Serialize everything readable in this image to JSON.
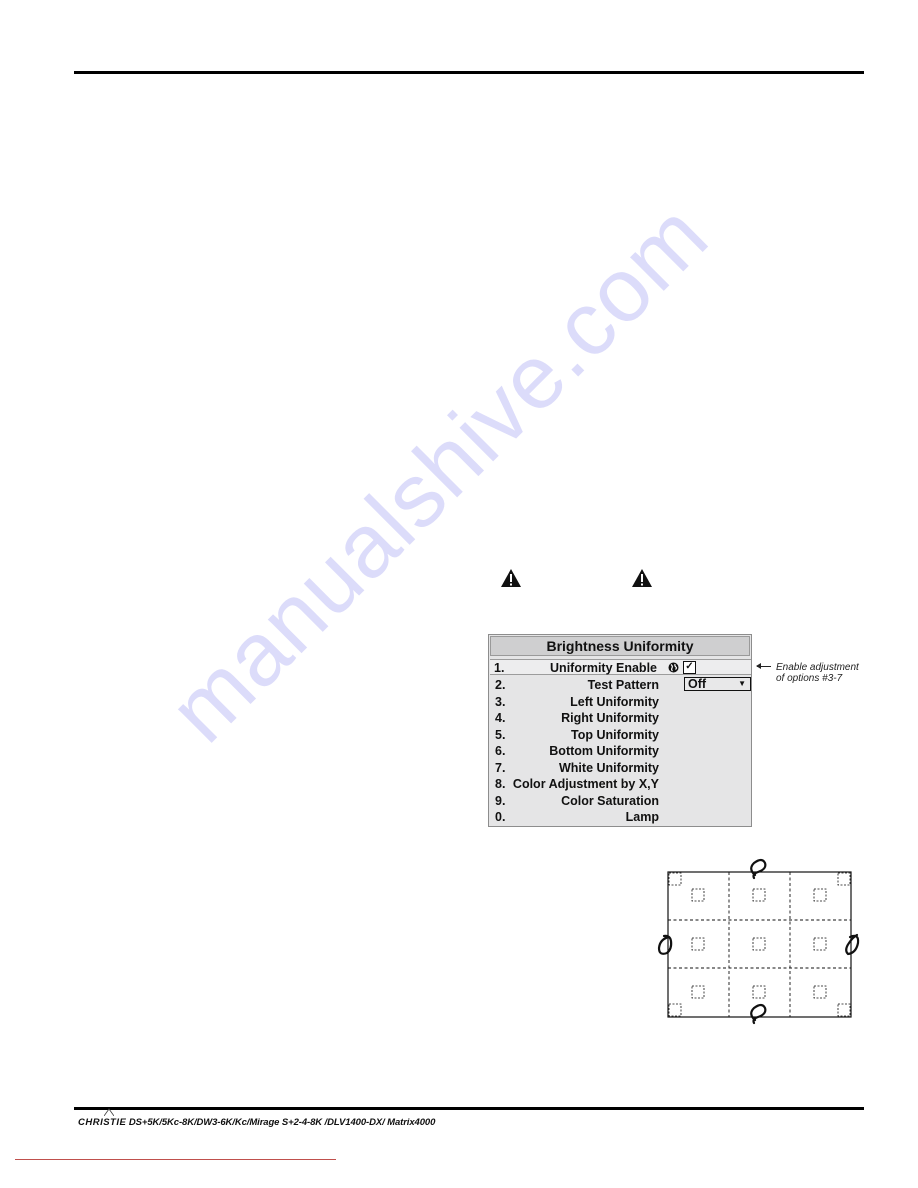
{
  "document": {
    "footer": {
      "brand": "CHRISTIE",
      "models": "DS+5K/5Kc-8K/DW3-6K/Kc/Mirage S+2-4-8K /DLV1400-DX/ Matrix4000"
    },
    "watermark": "manualshive.com",
    "warning_icons": [
      "warning-icon",
      "warning-icon"
    ]
  },
  "menu": {
    "title": "Brightness Uniformity",
    "items": [
      {
        "num": "1.",
        "label": "Uniformity Enable",
        "control": "checkbox",
        "checked": true,
        "icon": "globe-icon",
        "selected": true
      },
      {
        "num": "2.",
        "label": "Test Pattern",
        "control": "dropdown",
        "value": "Off"
      },
      {
        "num": "3.",
        "label": "Left Uniformity"
      },
      {
        "num": "4.",
        "label": "Right Uniformity"
      },
      {
        "num": "5.",
        "label": "Top Uniformity"
      },
      {
        "num": "6.",
        "label": "Bottom Uniformity"
      },
      {
        "num": "7.",
        "label": "White Uniformity"
      },
      {
        "num": "8.",
        "label": "Color Adjustment by X,Y"
      },
      {
        "num": "9.",
        "label": "Color Saturation"
      },
      {
        "num": "0.",
        "label": "Lamp"
      }
    ],
    "checkbox_mark": "✓",
    "dropdown_arrow": "▼"
  },
  "annotation": {
    "line1": "Enable adjustment",
    "line2": "of options #3-7"
  },
  "diagram": {
    "description": "3x3 screen zone grid with dashed measurement squares and adjustment knobs",
    "rows": 3,
    "cols": 3
  },
  "colors": {
    "menu_bg": "#e5e5e6",
    "menu_title_bg": "#cfcfd0",
    "watermark": "#9696f0",
    "link_line": "#c0504d"
  }
}
